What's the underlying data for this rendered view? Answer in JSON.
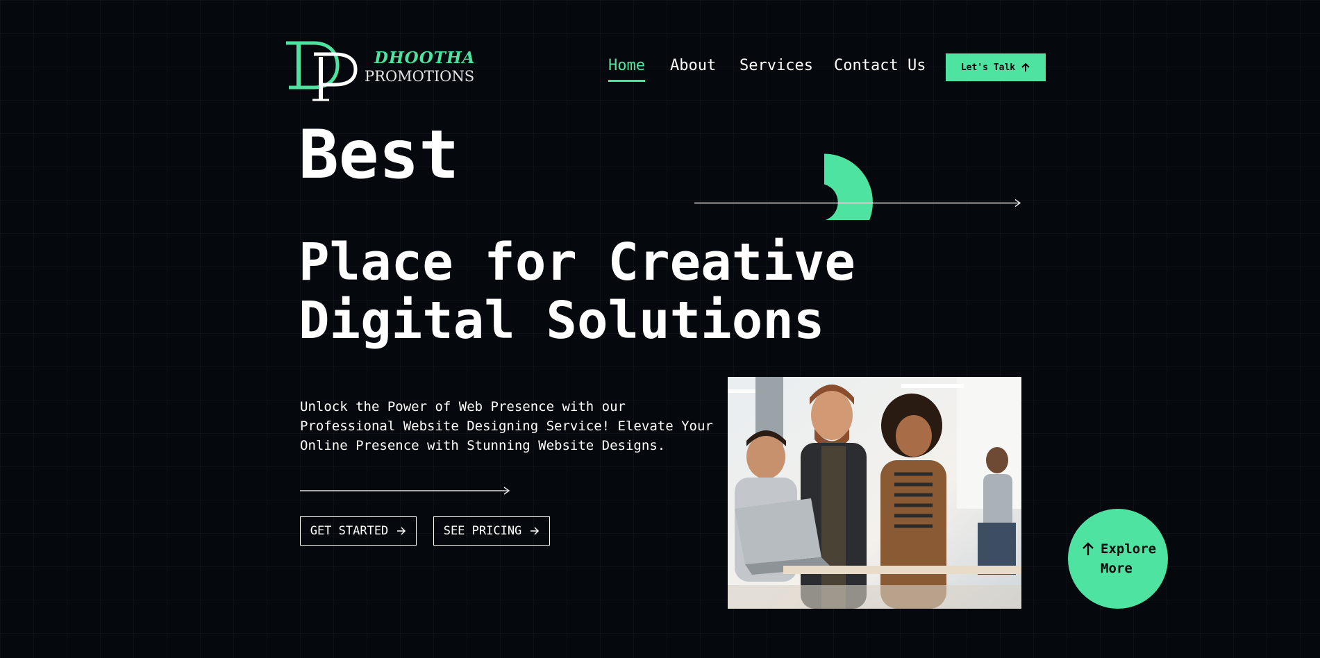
{
  "brand": {
    "name_line1": "DHOOTHA",
    "name_line2": "PROMOTIONS",
    "monogram": "DP"
  },
  "nav": {
    "items": [
      {
        "label": "Home",
        "active": true
      },
      {
        "label": "About",
        "active": false
      },
      {
        "label": "Services",
        "active": false
      },
      {
        "label": "Contact Us",
        "active": false
      }
    ],
    "cta_label": "Let's Talk",
    "cta_icon": "arrow-up-icon"
  },
  "hero": {
    "word": "Best",
    "title_line1": "Place for Creative",
    "title_line2": "Digital Solutions",
    "tagline_lines": [
      "Unlock the Power of Web Presence with our",
      "Professional Website Designing Service! Elevate Your",
      "Online Presence with Stunning Website Designs."
    ],
    "buttons": {
      "get_started": "GET STARTED",
      "see_pricing": "SEE PRICING"
    }
  },
  "explore": {
    "line1": "Explore",
    "line2": "More",
    "icon": "arrow-up-icon"
  },
  "colors": {
    "accent": "#4fe3a1",
    "background": "#05080c",
    "text": "#ffffff"
  }
}
